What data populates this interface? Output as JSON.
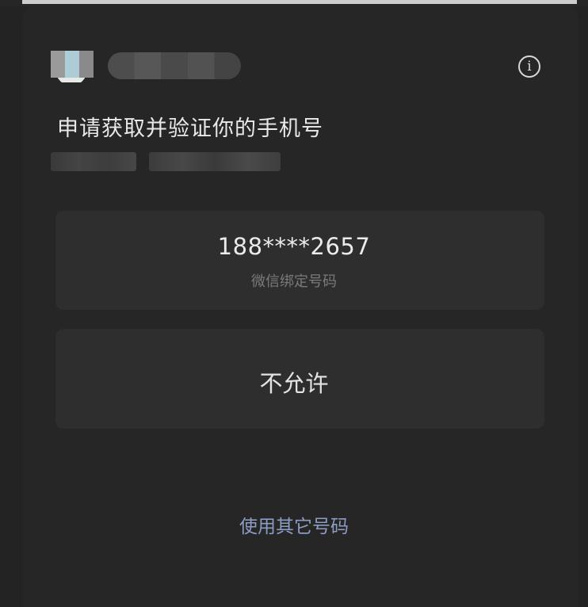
{
  "dialog": {
    "title": "申请获取并验证你的手机号",
    "info_icon": "info-icon"
  },
  "phone_option": {
    "number": "188****2657",
    "label": "微信绑定号码"
  },
  "deny_option": {
    "label": "不允许"
  },
  "other_number_link": {
    "label": "使用其它号码"
  },
  "colors": {
    "background": "#262626",
    "card": "#2e2e2e",
    "link": "#8d9cc2",
    "secondary_text": "#7a7a7a"
  }
}
